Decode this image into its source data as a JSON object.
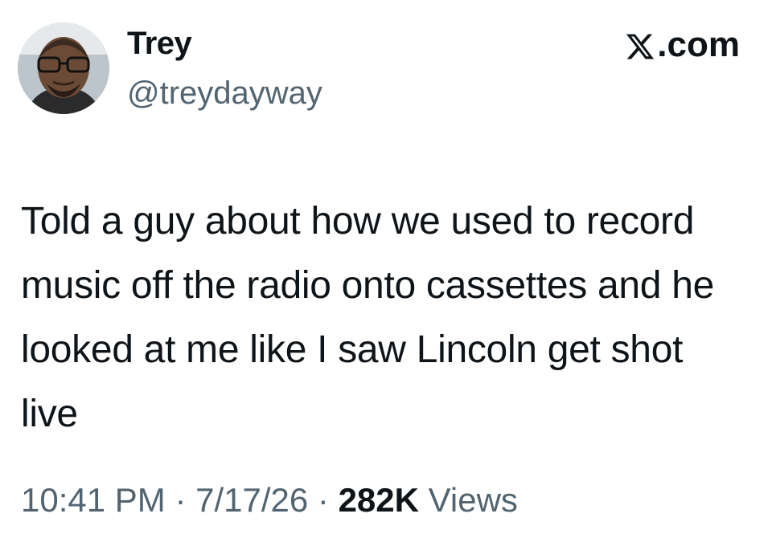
{
  "author": {
    "display_name": "Trey",
    "handle": "@treydayway",
    "avatar_icon": "profile-photo"
  },
  "site": {
    "label": ".com",
    "logo_icon": "x-logo-icon"
  },
  "tweet": {
    "text": "Told a guy about how we used to record music off the radio onto cassettes and he looked at me like I saw Lincoln get shot live"
  },
  "meta": {
    "time": "10:41 PM",
    "separator_1": " · ",
    "date": "7/17/26",
    "separator_2": " · ",
    "views_count": "282K",
    "views_label": " Views"
  },
  "colors": {
    "primary_text": "#0f1419",
    "secondary_text": "#536471",
    "background": "#ffffff"
  }
}
